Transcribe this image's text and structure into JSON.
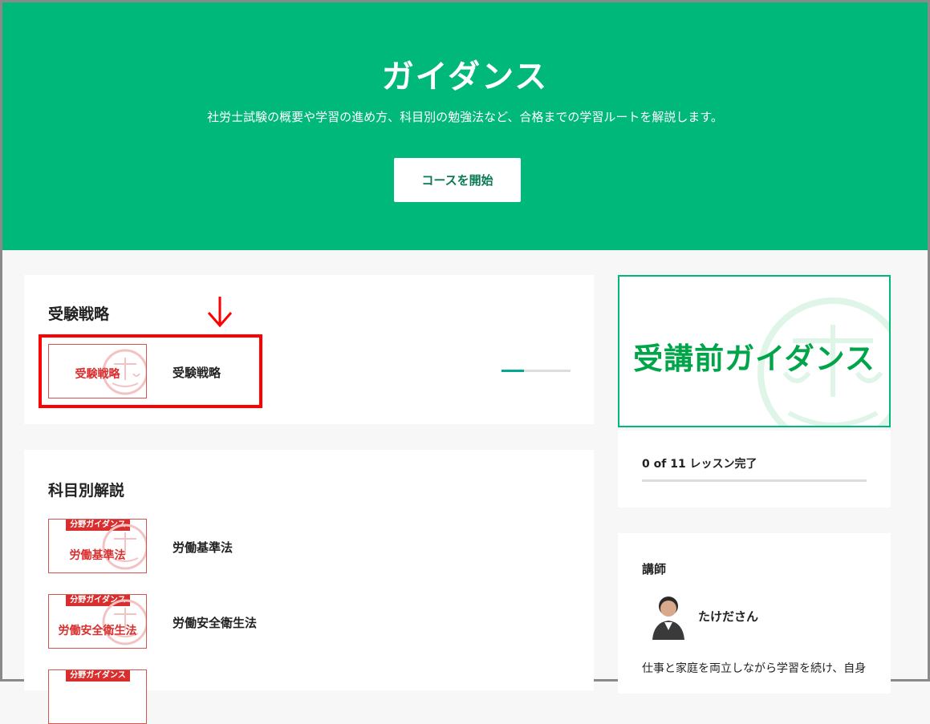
{
  "hero": {
    "title": "ガイダンス",
    "subtitle": "社労士試験の概要や学習の進め方、科目別の勉強法など、合格までの学習ルートを解説します。",
    "start_button": "コースを開始",
    "color": "#00b87a"
  },
  "section_strategy": {
    "title": "受験戦略",
    "lesson": {
      "thumb_text": "受験戦略",
      "label": "受験戦略",
      "progress": 0.33
    }
  },
  "section_subjects": {
    "title": "科目別解説",
    "lessons": [
      {
        "tag": "分野ガイダンス",
        "thumb_text": "労働基準法",
        "label": "労働基準法"
      },
      {
        "tag": "分野ガイダンス",
        "thumb_text": "労働安全衛生法",
        "label": "労働安全衛生法"
      },
      {
        "tag": "分野ガイダンス"
      }
    ]
  },
  "sidebar": {
    "banner_text": "受講前ガイダンス",
    "completion": "0 of 11 レッスン完了",
    "completion_fraction": 0,
    "instructor_heading": "講師",
    "instructor_name": "たけださん",
    "instructor_bio": "仕事と家庭を両立しながら学習を続け、自身"
  },
  "colors": {
    "accent": "#00b87a",
    "thumbnail_red": "#d92e2e",
    "highlight_red": "#ff0000",
    "progress": "#00a98f"
  },
  "icons": [
    "scales-seal-icon",
    "down-arrow-icon",
    "avatar"
  ]
}
